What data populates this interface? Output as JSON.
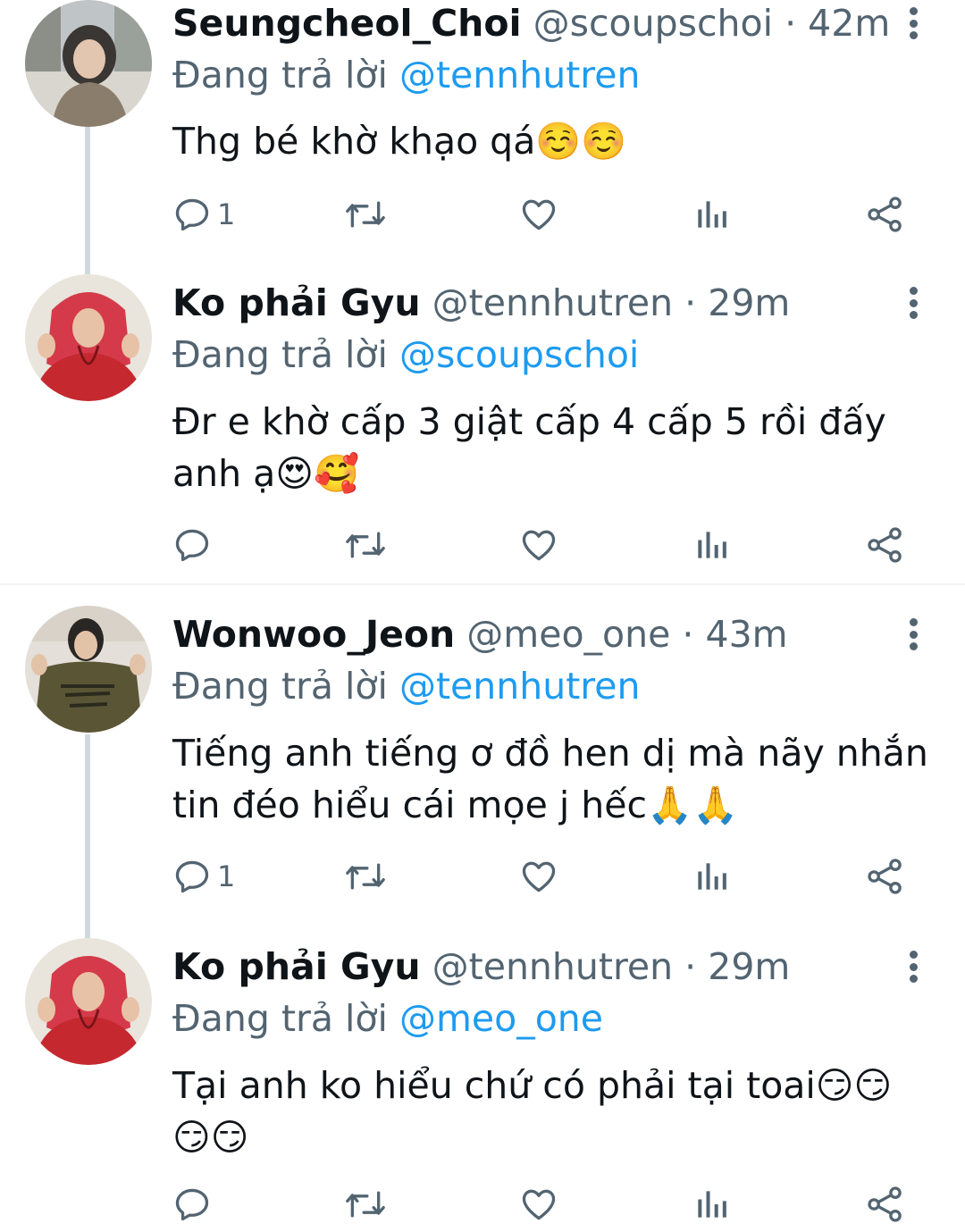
{
  "tweets": [
    {
      "name": "Seungcheol_Choi",
      "handle": "@scoupschoi",
      "separator": "·",
      "time": "42m",
      "reply_prefix": "Đang trả lời",
      "reply_mention": "@tennhutren",
      "lines": [
        "Thg bé khờ khạo qá☺️☺️"
      ],
      "reply_count": "1"
    },
    {
      "name": "Ko phải Gyu",
      "handle": "@tennhutren",
      "separator": "·",
      "time": "29m",
      "reply_prefix": "Đang trả lời",
      "reply_mention": "@scoupschoi",
      "lines": [
        "Đr e khờ cấp 3 giật cấp 4 cấp 5 rồi đấy",
        "anh ạ😍🥰"
      ],
      "reply_count": ""
    },
    {
      "name": "Wonwoo_Jeon",
      "handle": "@meo_one",
      "separator": "·",
      "time": "43m",
      "reply_prefix": "Đang trả lời",
      "reply_mention": "@tennhutren",
      "lines": [
        "Tiếng anh tiếng ơ đồ hen dị mà nãy nhắn",
        "tin đéo hiểu cái mọe j hếc🙏🙏"
      ],
      "reply_count": "1"
    },
    {
      "name": "Ko phải Gyu",
      "handle": "@tennhutren",
      "separator": "·",
      "time": "29m",
      "reply_prefix": "Đang trả lời",
      "reply_mention": "@meo_one",
      "lines": [
        "Tại anh ko hiểu chứ có phải tại toai😏😏",
        "😏😏"
      ],
      "reply_count": ""
    }
  ],
  "icons": {
    "reply": "reply-icon",
    "retweet": "retweet-icon",
    "like": "heart-icon",
    "views": "views-icon",
    "share": "share-icon",
    "more": "more-vertical-icon"
  },
  "colors": {
    "text": "#0f1419",
    "secondary": "#536471",
    "link": "#1d9bf0",
    "thread_line": "#cfd9de"
  }
}
